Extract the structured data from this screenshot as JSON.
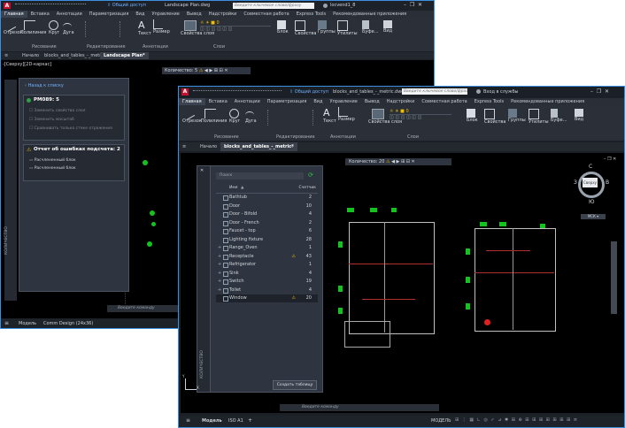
{
  "back_window": {
    "title_file": "Landscape Plan.dwg",
    "search_placeholder": "Введите ключевое слово/фразу",
    "user": "locvend1_8",
    "share": "Общий доступ",
    "ribbon_tabs": [
      "Главная",
      "Вставка",
      "Аннотации",
      "Параметризация",
      "Вид",
      "Управление",
      "Вывод",
      "Надстройки",
      "Совместная работа",
      "Express Tools",
      "Рекомендованные приложения"
    ],
    "tools": [
      "Отрезок",
      "Полилиния",
      "Круг",
      "Дуга",
      "Текст",
      "Размер",
      "Свойства слоя",
      "Блок",
      "Свойства",
      "Группы",
      "Утилиты",
      "Буфе...",
      "Вид"
    ],
    "group_labels": [
      "Рисование",
      "Редактирование",
      "Аннотации",
      "Слои"
    ],
    "doc_tabs": [
      "Начало",
      "blocks_and_tables_-_metric",
      "Landscape Plan*"
    ],
    "viewport_label": "-[Сверху][2D-каркас]",
    "qty_bar": {
      "label": "Количество:",
      "value": "5"
    },
    "panel": {
      "back_link": "Назад к списку",
      "block_title": "PM089: 5",
      "options": [
        "Заменить свойства слоя",
        "Заменить масштаб",
        "Сравнивать только стеке отражения"
      ],
      "error_report": "Отчет об ошибках подсчета: 2",
      "errors": [
        "Расчлененный блок",
        "Расчлененный блок"
      ],
      "side_label": "КОЛИЧЕСТВО"
    },
    "command_placeholder": "Введите команду",
    "status_tabs": [
      "Модель",
      "Comm Design (24x36)"
    ]
  },
  "front_window": {
    "title_file": "blocks_and_tables_-_metric.dwg",
    "search_placeholder": "Введите ключевое слово/фразу",
    "user": "Вход в службы",
    "share": "Общий доступ",
    "ribbon_tabs": [
      "Главная",
      "Вставка",
      "Аннотации",
      "Параметризация",
      "Вид",
      "Управление",
      "Вывод",
      "Надстройки",
      "Совместная работа",
      "Express Tools",
      "Рекомендованные приложения"
    ],
    "tools": [
      "Отрезок",
      "Полилиния",
      "Круг",
      "Дуга",
      "Текст",
      "Размер",
      "Свойства слоя",
      "Блок",
      "Свойства",
      "Группы",
      "Утилиты",
      "Буфе...",
      "Вид"
    ],
    "group_labels": [
      "Рисование",
      "Редактирование",
      "Аннотации",
      "Слои"
    ],
    "doc_tabs": [
      "Начало",
      "blocks_and_tables_-_metric*"
    ],
    "qty_bar": {
      "label": "Количество:",
      "value": "20"
    },
    "palette": {
      "search_placeholder": "Поиск",
      "col_name": "Имя",
      "col_count": "Счетчик",
      "rows": [
        {
          "name": "Bathtub",
          "count": "2",
          "expand": false,
          "warn": false
        },
        {
          "name": "Door",
          "count": "10",
          "expand": false,
          "warn": false
        },
        {
          "name": "Door - Bifold",
          "count": "4",
          "expand": false,
          "warn": false
        },
        {
          "name": "Door - French",
          "count": "2",
          "expand": false,
          "warn": false
        },
        {
          "name": "Faucet - top",
          "count": "6",
          "expand": false,
          "warn": false
        },
        {
          "name": "Lighting fixture",
          "count": "28",
          "expand": false,
          "warn": false
        },
        {
          "name": "Range_Oven",
          "count": "1",
          "expand": true,
          "warn": false
        },
        {
          "name": "Receptacle",
          "count": "43",
          "expand": true,
          "warn": true
        },
        {
          "name": "Refrigerator",
          "count": "1",
          "expand": true,
          "warn": false
        },
        {
          "name": "Sink",
          "count": "4",
          "expand": true,
          "warn": false
        },
        {
          "name": "Switch",
          "count": "19",
          "expand": true,
          "warn": false
        },
        {
          "name": "Toilet",
          "count": "4",
          "expand": true,
          "warn": false
        },
        {
          "name": "Window",
          "count": "20",
          "expand": false,
          "warn": true
        }
      ],
      "selected_index": 12,
      "create_table": "Создать таблицу",
      "side_label": "КОЛИЧЕСТВО"
    },
    "viewcube": {
      "n": "С",
      "s": "Ю",
      "w": "З",
      "e": "В",
      "face": "Сверху",
      "wcs": "МСК"
    },
    "command_placeholder": "Введите команду",
    "status_tabs": [
      "Модель",
      "ISO A1"
    ],
    "status_right": "МОДЕЛЬ"
  },
  "colors": {
    "accent": "#3d8fe0",
    "block_green": "#13c41f",
    "warning": "#f0b400",
    "canvas": "#000000"
  }
}
